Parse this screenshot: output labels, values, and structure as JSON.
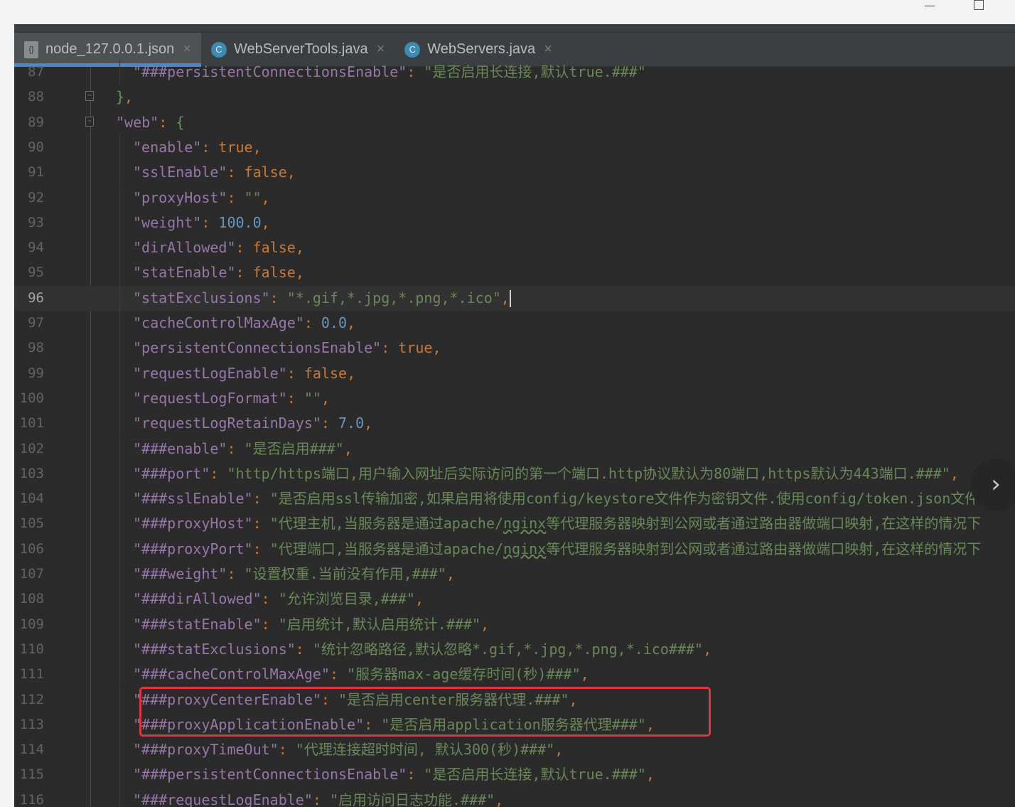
{
  "tabs": [
    {
      "label": "node_127.0.0.1.json",
      "icon": "json-file-icon",
      "active": true
    },
    {
      "label": "WebServerTools.java",
      "icon": "java-class-icon",
      "active": false
    },
    {
      "label": "WebServers.java",
      "icon": "java-class-icon",
      "active": false
    }
  ],
  "current_line": "96",
  "colors": {
    "background": "#2b2b2b",
    "key": "#9876aa",
    "string": "#6a8759",
    "punct": "#cc7832",
    "number": "#6897bb",
    "highlight_box": "#e3333c"
  },
  "lines": [
    {
      "n": "87",
      "i": 1,
      "t": [
        [
          "k",
          "\"###persistentConnectionsEnable\""
        ],
        [
          "p",
          ": "
        ],
        [
          "s",
          "\"是否启用长连接,默认true.###\""
        ]
      ]
    },
    {
      "n": "88",
      "i": 0,
      "t": [
        [
          "g",
          "}"
        ],
        [
          "p",
          ","
        ]
      ]
    },
    {
      "n": "89",
      "i": 0,
      "t": [
        [
          "k",
          "\"web\""
        ],
        [
          "p",
          ": "
        ],
        [
          "g",
          "{"
        ]
      ]
    },
    {
      "n": "90",
      "i": 1,
      "t": [
        [
          "k",
          "\"enable\""
        ],
        [
          "p",
          ": "
        ],
        [
          "b",
          "true"
        ],
        [
          "p",
          ","
        ]
      ]
    },
    {
      "n": "91",
      "i": 1,
      "t": [
        [
          "k",
          "\"sslEnable\""
        ],
        [
          "p",
          ": "
        ],
        [
          "b",
          "false"
        ],
        [
          "p",
          ","
        ]
      ]
    },
    {
      "n": "92",
      "i": 1,
      "t": [
        [
          "k",
          "\"proxyHost\""
        ],
        [
          "p",
          ": "
        ],
        [
          "s",
          "\"\""
        ],
        [
          "p",
          ","
        ]
      ]
    },
    {
      "n": "93",
      "i": 1,
      "t": [
        [
          "k",
          "\"weight\""
        ],
        [
          "p",
          ": "
        ],
        [
          "n",
          "100.0"
        ],
        [
          "p",
          ","
        ]
      ]
    },
    {
      "n": "94",
      "i": 1,
      "t": [
        [
          "k",
          "\"dirAllowed\""
        ],
        [
          "p",
          ": "
        ],
        [
          "b",
          "false"
        ],
        [
          "p",
          ","
        ]
      ]
    },
    {
      "n": "95",
      "i": 1,
      "t": [
        [
          "k",
          "\"statEnable\""
        ],
        [
          "p",
          ": "
        ],
        [
          "b",
          "false"
        ],
        [
          "p",
          ","
        ]
      ]
    },
    {
      "n": "96",
      "i": 1,
      "t": [
        [
          "k",
          "\"statExclusions\""
        ],
        [
          "p",
          ": "
        ],
        [
          "s",
          "\"*.gif,*.jpg,*.png,*.ico\""
        ],
        [
          "p",
          ","
        ]
      ]
    },
    {
      "n": "97",
      "i": 1,
      "t": [
        [
          "k",
          "\"cacheControlMaxAge\""
        ],
        [
          "p",
          ": "
        ],
        [
          "n",
          "0.0"
        ],
        [
          "p",
          ","
        ]
      ]
    },
    {
      "n": "98",
      "i": 1,
      "t": [
        [
          "k",
          "\"persistentConnectionsEnable\""
        ],
        [
          "p",
          ": "
        ],
        [
          "b",
          "true"
        ],
        [
          "p",
          ","
        ]
      ]
    },
    {
      "n": "99",
      "i": 1,
      "t": [
        [
          "k",
          "\"requestLogEnable\""
        ],
        [
          "p",
          ": "
        ],
        [
          "b",
          "false"
        ],
        [
          "p",
          ","
        ]
      ]
    },
    {
      "n": "100",
      "i": 1,
      "t": [
        [
          "k",
          "\"requestLogFormat\""
        ],
        [
          "p",
          ": "
        ],
        [
          "s",
          "\"\""
        ],
        [
          "p",
          ","
        ]
      ]
    },
    {
      "n": "101",
      "i": 1,
      "t": [
        [
          "k",
          "\"requestLogRetainDays\""
        ],
        [
          "p",
          ": "
        ],
        [
          "n",
          "7.0"
        ],
        [
          "p",
          ","
        ]
      ]
    },
    {
      "n": "102",
      "i": 1,
      "t": [
        [
          "k",
          "\"###enable\""
        ],
        [
          "p",
          ": "
        ],
        [
          "s",
          "\"是否启用###\""
        ],
        [
          "p",
          ","
        ]
      ]
    },
    {
      "n": "103",
      "i": 1,
      "t": [
        [
          "k",
          "\"###port\""
        ],
        [
          "p",
          ": "
        ],
        [
          "s",
          "\"http/https端口,用户输入网址后实际访问的第一个端口.http协议默认为80端口,https默认为443端口.###\""
        ],
        [
          "p",
          ","
        ]
      ]
    },
    {
      "n": "104",
      "i": 1,
      "t": [
        [
          "k",
          "\"###sslEnable\""
        ],
        [
          "p",
          ": "
        ],
        [
          "s",
          "\"是否启用ssl传输加密,如果启用将使用config/keystore文件作为密钥文件.使用config/token.json文件"
        ]
      ]
    },
    {
      "n": "105",
      "i": 1,
      "t": [
        [
          "k",
          "\"###proxyHost\""
        ],
        [
          "p",
          ": "
        ],
        [
          "s",
          "\"代理主机,当服务器是通过apache/"
        ],
        [
          "w",
          "nginx"
        ],
        [
          "s",
          "等代理服务器映射到公网或者通过路由器做端口映射,在这样的情况下"
        ]
      ]
    },
    {
      "n": "106",
      "i": 1,
      "t": [
        [
          "k",
          "\"###proxyPort\""
        ],
        [
          "p",
          ": "
        ],
        [
          "s",
          "\"代理端口,当服务器是通过apache/"
        ],
        [
          "w",
          "nginx"
        ],
        [
          "s",
          "等代理服务器映射到公网或者通过路由器做端口映射,在这样的情况下"
        ]
      ]
    },
    {
      "n": "107",
      "i": 1,
      "t": [
        [
          "k",
          "\"###weight\""
        ],
        [
          "p",
          ": "
        ],
        [
          "s",
          "\"设置权重.当前没有作用,###\""
        ],
        [
          "p",
          ","
        ]
      ]
    },
    {
      "n": "108",
      "i": 1,
      "t": [
        [
          "k",
          "\"###dirAllowed\""
        ],
        [
          "p",
          ": "
        ],
        [
          "s",
          "\"允许浏览目录,###\""
        ],
        [
          "p",
          ","
        ]
      ]
    },
    {
      "n": "109",
      "i": 1,
      "t": [
        [
          "k",
          "\"###statEnable\""
        ],
        [
          "p",
          ": "
        ],
        [
          "s",
          "\"启用统计,默认启用统计.###\""
        ],
        [
          "p",
          ","
        ]
      ]
    },
    {
      "n": "110",
      "i": 1,
      "t": [
        [
          "k",
          "\"###statExclusions\""
        ],
        [
          "p",
          ": "
        ],
        [
          "s",
          "\"统计忽略路径,默认忽略*.gif,*.jpg,*.png,*.ico###\""
        ],
        [
          "p",
          ","
        ]
      ]
    },
    {
      "n": "111",
      "i": 1,
      "t": [
        [
          "k",
          "\"###cacheControlMaxAge\""
        ],
        [
          "p",
          ": "
        ],
        [
          "s",
          "\"服务器max-age缓存时间(秒)###\""
        ],
        [
          "p",
          ","
        ]
      ]
    },
    {
      "n": "112",
      "i": 1,
      "t": [
        [
          "k",
          "\"###proxyCenterEnable\""
        ],
        [
          "p",
          ": "
        ],
        [
          "s",
          "\"是否启用center服务器代理.###\""
        ],
        [
          "p",
          ","
        ]
      ]
    },
    {
      "n": "113",
      "i": 1,
      "t": [
        [
          "k",
          "\"###proxyApplicationEnable\""
        ],
        [
          "p",
          ": "
        ],
        [
          "s",
          "\"是否启用application服务器代理###\""
        ],
        [
          "p",
          ","
        ]
      ]
    },
    {
      "n": "114",
      "i": 1,
      "t": [
        [
          "k",
          "\"###proxyTimeOut\""
        ],
        [
          "p",
          ": "
        ],
        [
          "s",
          "\"代理连接超时时间, 默认300(秒)###\""
        ],
        [
          "p",
          ","
        ]
      ]
    },
    {
      "n": "115",
      "i": 1,
      "t": [
        [
          "k",
          "\"###persistentConnectionsEnable\""
        ],
        [
          "p",
          ": "
        ],
        [
          "s",
          "\"是否启用长连接,默认true.###\""
        ],
        [
          "p",
          ","
        ]
      ]
    },
    {
      "n": "116",
      "i": 1,
      "t": [
        [
          "k",
          "\"###requestLogEnable\""
        ],
        [
          "p",
          ": "
        ],
        [
          "s",
          "\"启用访问日志功能.###\""
        ],
        [
          "p",
          ","
        ]
      ]
    }
  ]
}
